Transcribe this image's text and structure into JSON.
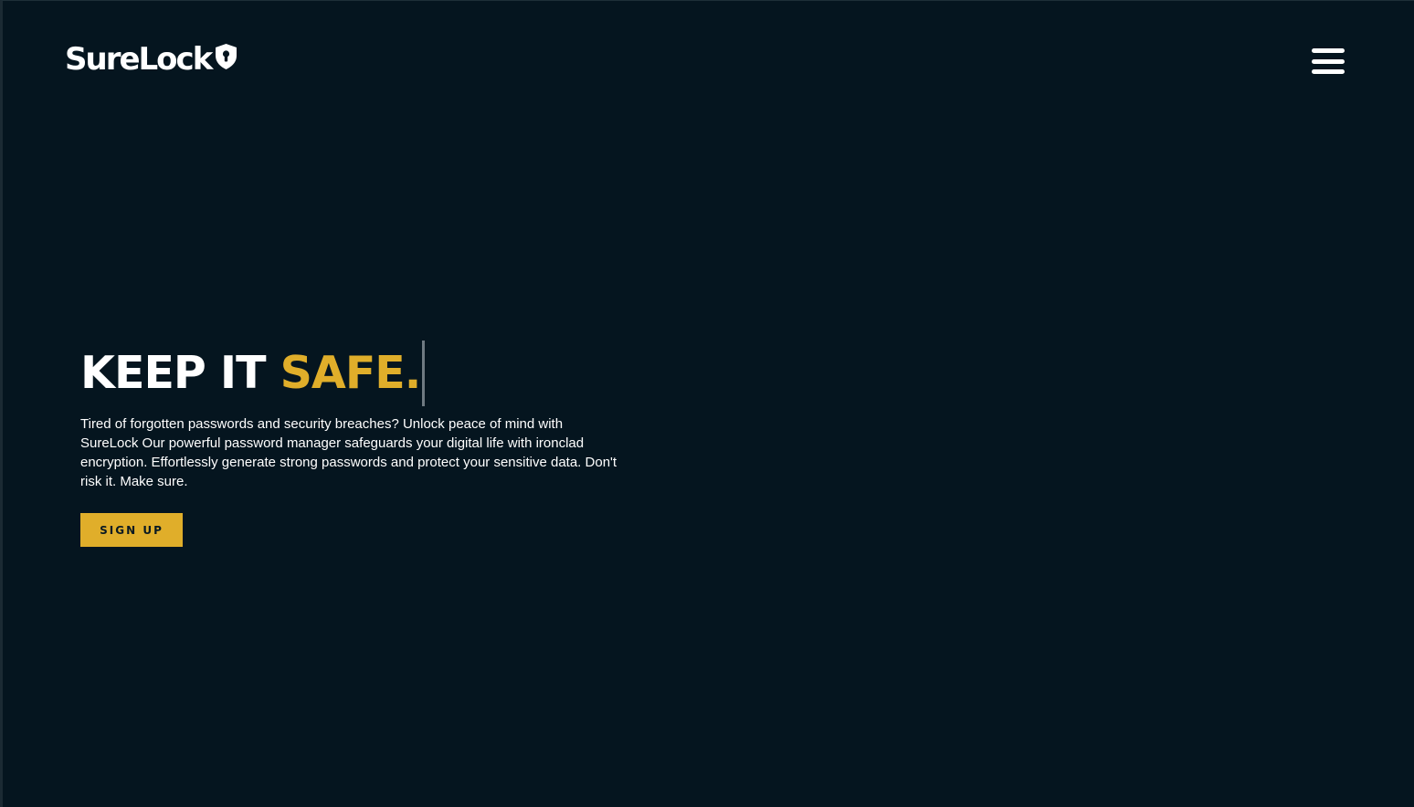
{
  "brand": {
    "name": "SureLock",
    "logo_icon": "shield-keyhole-icon"
  },
  "nav": {
    "menu_icon": "hamburger-menu-icon"
  },
  "hero": {
    "headline_prefix": "KEEP IT ",
    "headline_accent": "SAFE.",
    "description": "Tired of forgotten passwords and security breaches? Unlock peace of mind with SureLock Our powerful password manager safeguards your digital life with ironclad encryption. Effortlessly generate strong passwords and protect your sensitive data. Don't risk it. Make sure.",
    "cta_label": "SIGN UP"
  },
  "colors": {
    "background": "#05151f",
    "accent": "#e0ae2a",
    "text": "#ffffff"
  }
}
